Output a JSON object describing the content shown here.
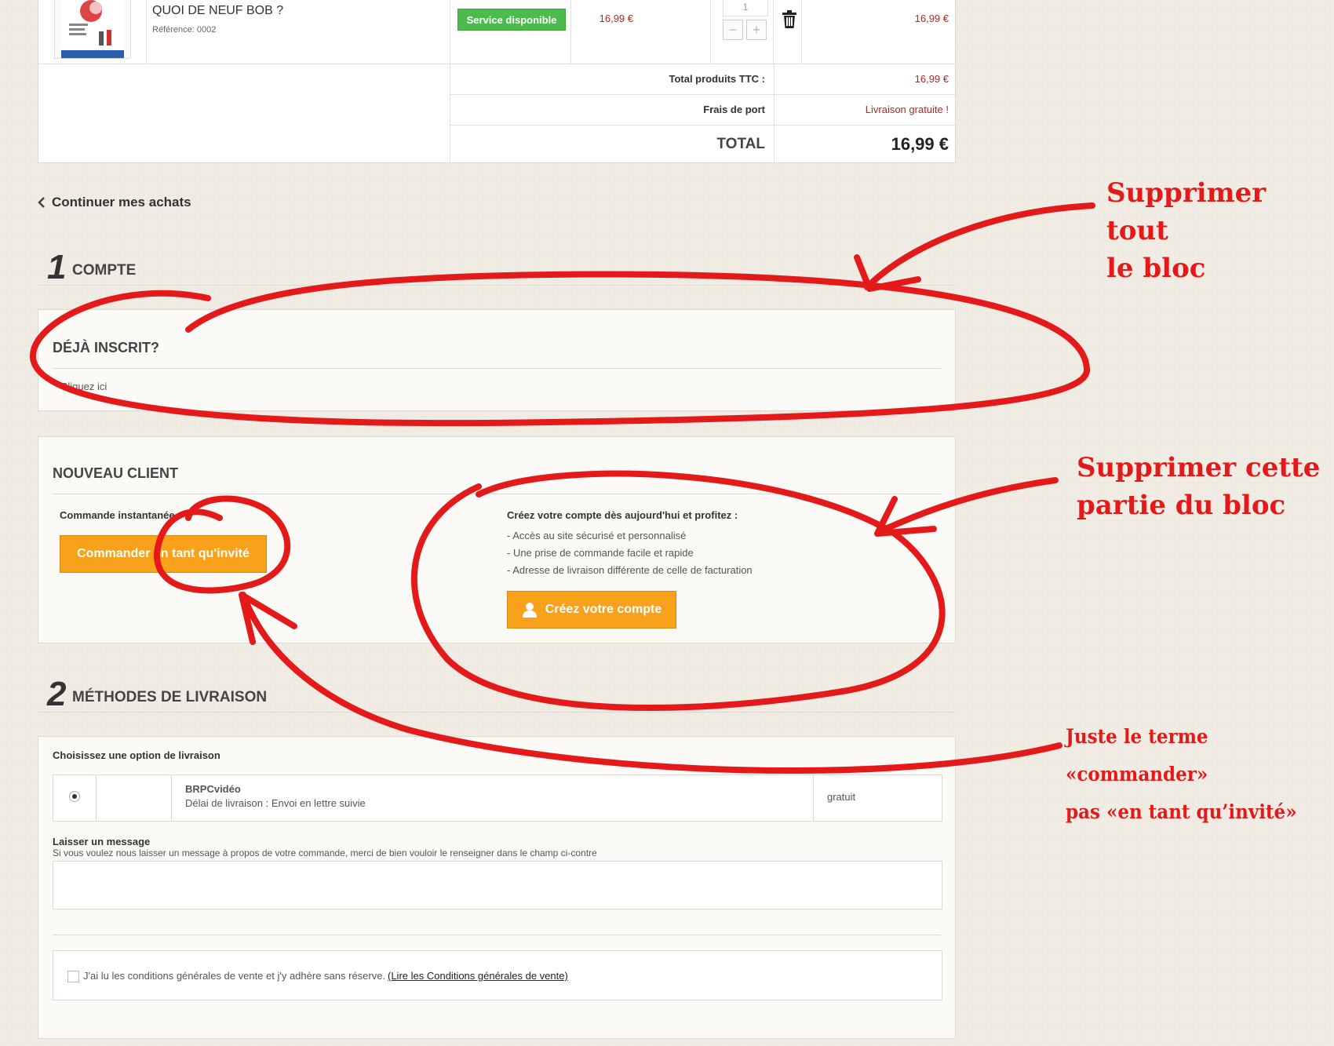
{
  "product": {
    "name": "QUOI DE NEUF BOB ?",
    "reference": "Référence: 0002",
    "availability": "Service disponible",
    "unit_price": "16,99 €",
    "quantity": "1",
    "total": "16,99 €",
    "qty_minus": "−",
    "qty_plus": "+"
  },
  "totals": {
    "products_label": "Total produits TTC :",
    "products_value": "16,99 €",
    "shipping_label": "Frais de port",
    "shipping_value": "Livraison gratuite !",
    "total_label": "TOTAL",
    "total_value": "16,99 €"
  },
  "continue_shopping": "Continuer mes achats",
  "step1": {
    "number": "1",
    "title": "COMPTE",
    "already_registered": {
      "title": "DÉJÀ INSCRIT?",
      "link": "Cliquez ici"
    },
    "new_client": {
      "title": "NOUVEAU CLIENT",
      "instant_label": "Commande instantanée",
      "guest_button": "Commander en tant qu'invité",
      "create_heading": "Créez votre compte dès aujourd'hui et profitez :",
      "benefits": [
        "- Accès au site sécurisé et personnalisé",
        "- Une prise de commande facile et rapide",
        "- Adresse de livraison différente de celle de facturation"
      ],
      "create_button": "Créez votre compte"
    }
  },
  "step2": {
    "number": "2",
    "title": "MÉTHODES DE LIVRAISON",
    "choose_label": "Choisissez une option de livraison",
    "carrier_name": "BRPCvidéo",
    "carrier_delay": "Délai de livraison : Envoi en lettre suivie",
    "carrier_price": "gratuit",
    "message_label": "Laisser un message",
    "message_help": "Si vous voulez nous laisser un message à propos de votre commande, merci de bien vouloir le renseigner dans le champ ci-contre",
    "terms_text": "J'ai lu les conditions générales de vente et j'y adhère sans réserve.",
    "terms_link": "(Lire les Conditions générales de vente)"
  },
  "annotations": {
    "note1_line1": "Supprimer tout",
    "note1_line2": "le bloc",
    "note2_line1": "Supprimer cette",
    "note2_line2": "partie du bloc",
    "note3_line1": "Juste le terme «commander»",
    "note3_line2": "pas «en tant qu’invité»",
    "ink_color": "#e41a1a"
  },
  "colors": {
    "accent_orange": "#f8a11a",
    "available_green": "#4cba4c",
    "price_red": "#b22727",
    "page_bg": "#f0ece4"
  }
}
